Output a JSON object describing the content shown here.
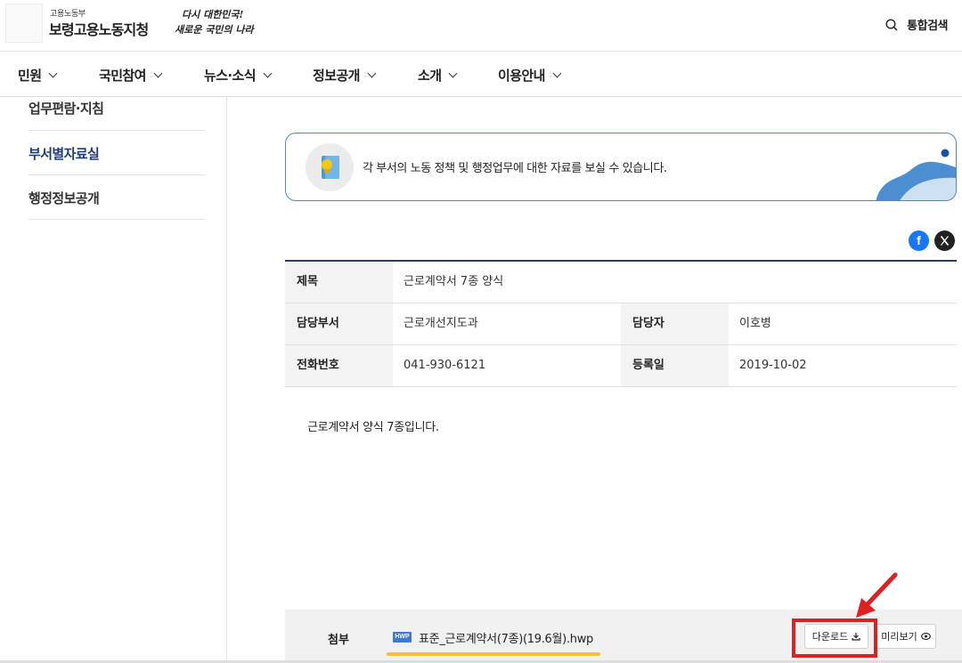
{
  "header": {
    "org_small": "고용노동부",
    "org_name": "보령고용노동지청",
    "slogan_line1": "다시 대한민국!",
    "slogan_line2": "새로운 국민의 나라",
    "search_label": "통합검색",
    "search_icon": "search-icon"
  },
  "nav": {
    "items": [
      "민원",
      "국민참여",
      "뉴스·소식",
      "정보공개",
      "소개",
      "이용안내"
    ]
  },
  "sidebar": {
    "items": [
      {
        "label": "업무편람·지침",
        "active": false
      },
      {
        "label": "부서별자료실",
        "active": true
      },
      {
        "label": "행정정보공개",
        "active": false
      }
    ]
  },
  "intro": {
    "text": "각 부서의 노동 정책 및 행정업무에 대한 자료를 보실 수 있습니다.",
    "icon": "book-lightbulb-icon"
  },
  "sns": {
    "facebook": "f",
    "x": "x-icon"
  },
  "table": {
    "title_label": "제목",
    "title_value": "근로계약서 7종 양식",
    "dept_label": "담당부서",
    "dept_value": "근로개선지도과",
    "manager_label": "담당자",
    "manager_value": "이호병",
    "phone_label": "전화번호",
    "phone_value": "041-930-6121",
    "date_label": "등록일",
    "date_value": "2019-10-02"
  },
  "content": {
    "body": "근로계약서 양식 7종입니다."
  },
  "attachment": {
    "label": "첨부",
    "file_type": "HWP",
    "file_name": "표준_근로계약서(7종)(19.6월).hwp",
    "download_label": "다운로드",
    "preview_label": "미리보기"
  },
  "colors": {
    "accent": "#1b3a7a",
    "highlight": "#f6c22a",
    "annotation": "#e02020",
    "facebook": "#1877f2"
  }
}
